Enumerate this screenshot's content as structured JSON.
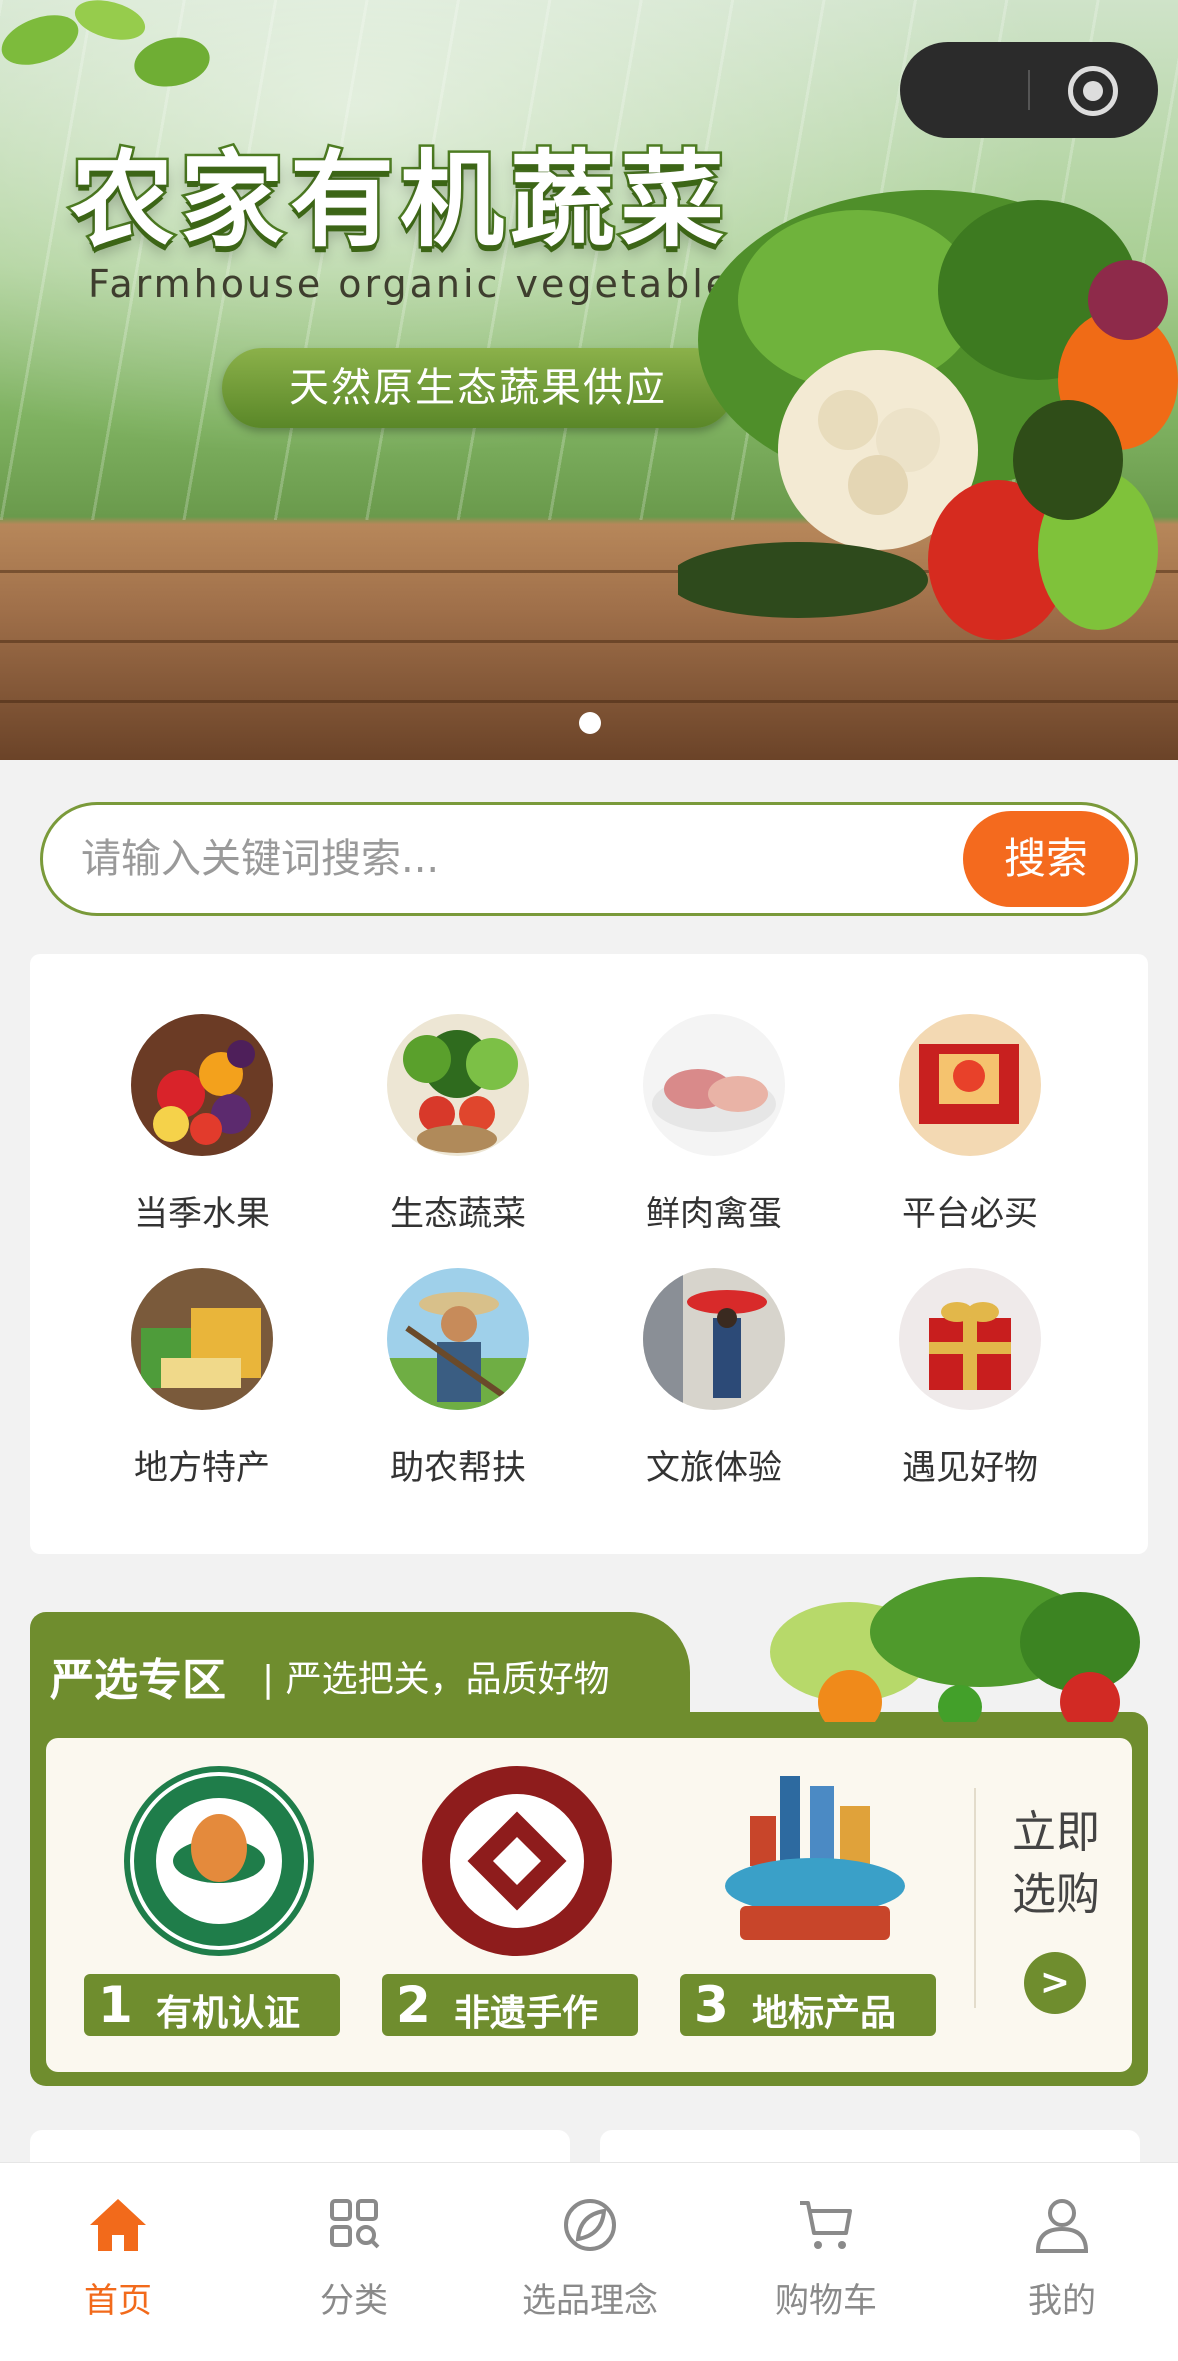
{
  "banner": {
    "title": "农家有机蔬菜",
    "subtitle": "Farmhouse organic vegetables",
    "pill": "天然原生态蔬果供应"
  },
  "search": {
    "placeholder": "请输入关键词搜索...",
    "button": "搜索"
  },
  "categories": [
    {
      "label": "当季水果",
      "icon": "fruit-icon"
    },
    {
      "label": "生态蔬菜",
      "icon": "vegetable-icon"
    },
    {
      "label": "鲜肉禽蛋",
      "icon": "meat-icon"
    },
    {
      "label": "平台必买",
      "icon": "gift-box-icon"
    },
    {
      "label": "地方特产",
      "icon": "specialty-icon"
    },
    {
      "label": "助农帮扶",
      "icon": "farmer-icon"
    },
    {
      "label": "文旅体验",
      "icon": "travel-icon"
    },
    {
      "label": "遇见好物",
      "icon": "present-icon"
    }
  ],
  "zone": {
    "title": "严选专区",
    "slogan": "| 严选把关，品质好物",
    "badges": [
      {
        "num": "1",
        "text": "有机认证",
        "icon": "organic-seal-icon"
      },
      {
        "num": "2",
        "text": "非遗手作",
        "icon": "heritage-seal-icon"
      },
      {
        "num": "3",
        "text": "地标产品",
        "icon": "landmark-icon"
      }
    ],
    "buy_now": "立即选购",
    "arrow": ">"
  },
  "tabbar": {
    "items": [
      {
        "label": "首页",
        "icon": "home-icon",
        "active": true
      },
      {
        "label": "分类",
        "icon": "category-icon",
        "active": false
      },
      {
        "label": "选品理念",
        "icon": "leaf-icon",
        "active": false
      },
      {
        "label": "购物车",
        "icon": "cart-icon",
        "active": false
      },
      {
        "label": "我的",
        "icon": "user-icon",
        "active": false
      }
    ]
  },
  "colors": {
    "accent": "#f46a1e",
    "brand_green": "#6f8d2e"
  }
}
